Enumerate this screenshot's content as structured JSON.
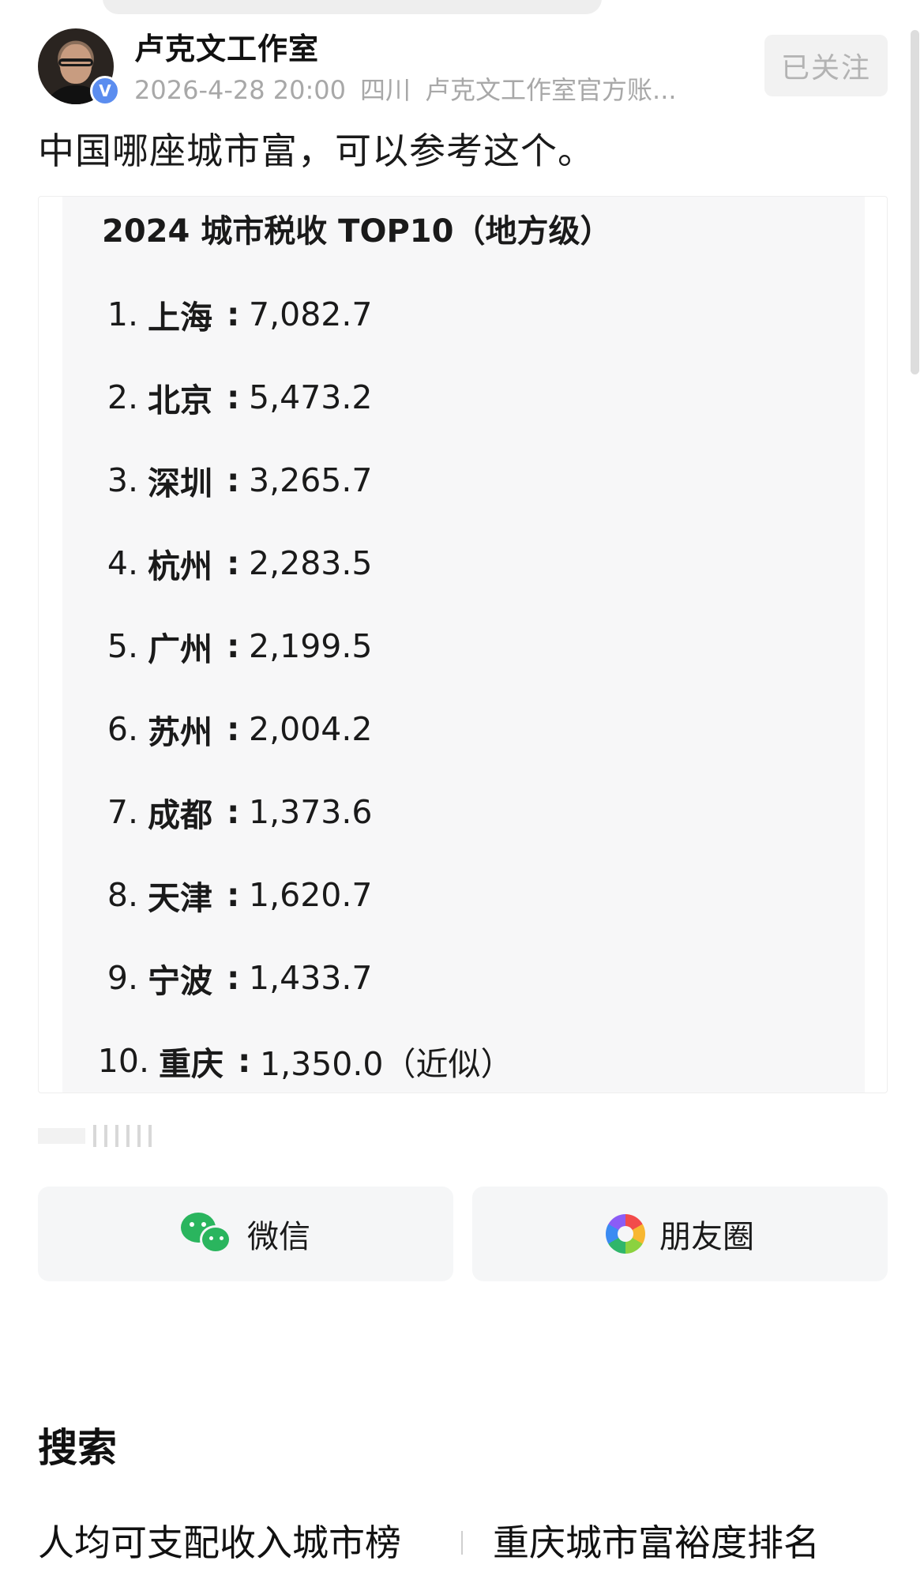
{
  "header": {
    "author_name": "卢克文工作室",
    "verified_badge": "V",
    "date": "2026-4-28 20:00",
    "location": "四川",
    "account_desc": "卢克文工作室官方账...",
    "follow_label": "已关注"
  },
  "post": {
    "text": "中国哪座城市富，可以参考这个。"
  },
  "ranking": {
    "title": "2024 城市税收 TOP10（地方级）",
    "items": [
      {
        "num": "1.",
        "city": "上海",
        "value": "7,082.7"
      },
      {
        "num": "2.",
        "city": "北京",
        "value": "5,473.2"
      },
      {
        "num": "3.",
        "city": "深圳",
        "value": "3,265.7"
      },
      {
        "num": "4.",
        "city": "杭州",
        "value": "2,283.5"
      },
      {
        "num": "5.",
        "city": "广州",
        "value": "2,199.5"
      },
      {
        "num": "6.",
        "city": "苏州",
        "value": "2,004.2"
      },
      {
        "num": "7.",
        "city": "成都",
        "value": "1,373.6"
      },
      {
        "num": "8.",
        "city": "天津",
        "value": "1,620.7"
      },
      {
        "num": "9.",
        "city": "宁波",
        "value": "1,433.7"
      },
      {
        "num": "10.",
        "city": "重庆",
        "value": "1,350.0（近似）"
      }
    ]
  },
  "share": {
    "wechat_label": "微信",
    "moments_label": "朋友圈"
  },
  "search": {
    "title": "搜索",
    "items": [
      "人均可支配收入城市榜",
      "重庆城市富裕度排名"
    ]
  },
  "colors": {
    "wechat_green": "#2ab55e",
    "verified_blue": "#5b8def",
    "muted_text": "#a8a8a8"
  }
}
